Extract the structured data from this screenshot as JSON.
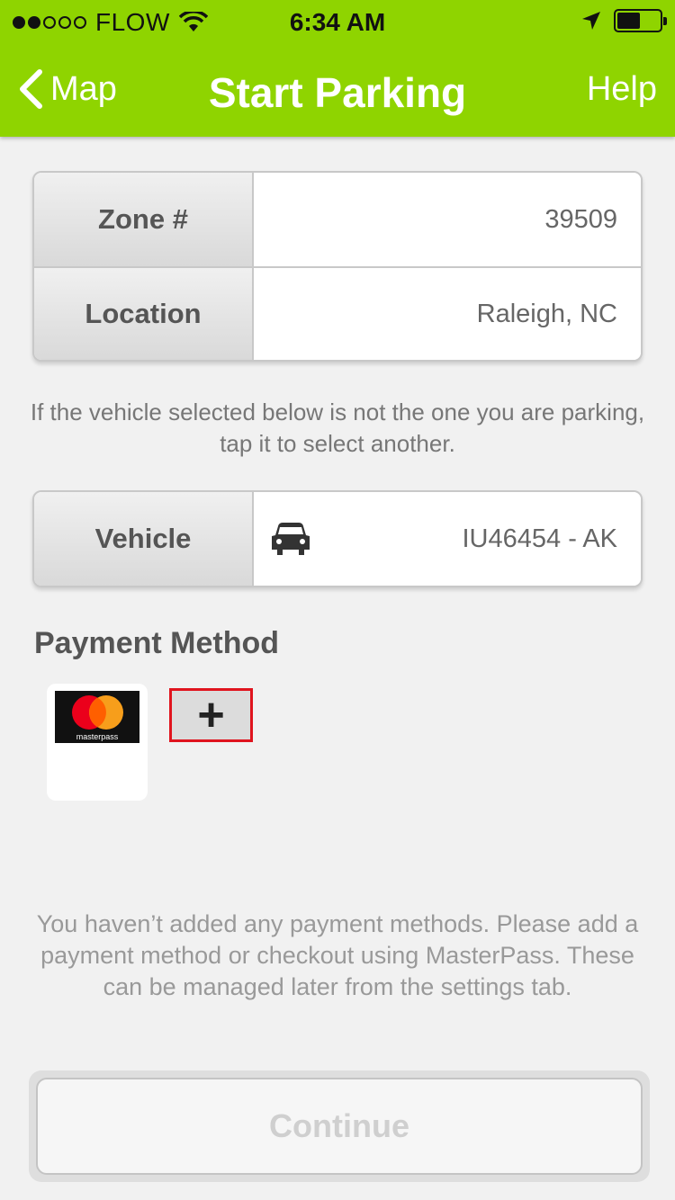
{
  "status_bar": {
    "carrier": "FLOW",
    "time": "6:34 AM",
    "signal_filled": 2,
    "signal_total": 5,
    "battery_level": 0.55
  },
  "nav": {
    "back_label": "Map",
    "title": "Start Parking",
    "help_label": "Help"
  },
  "zone_card": {
    "zone_label": "Zone #",
    "zone_value": "39509",
    "location_label": "Location",
    "location_value": "Raleigh, NC"
  },
  "vehicle_hint": "If the vehicle selected below is not the one you are parking, tap it to select another.",
  "vehicle": {
    "label": "Vehicle",
    "value": "IU46454 - AK",
    "icon": "car-icon"
  },
  "payment": {
    "title": "Payment Method",
    "masterpass_label": "masterpass",
    "add_symbol": "+",
    "info": "You haven’t added any payment methods. Please add a payment method or checkout using MasterPass. These can be managed later from the settings tab."
  },
  "continue_label": "Continue",
  "colors": {
    "header": "#8fd400",
    "add_border": "#e0141e",
    "mastercard_red": "#eb001b",
    "mastercard_orange": "#f79e1b"
  }
}
